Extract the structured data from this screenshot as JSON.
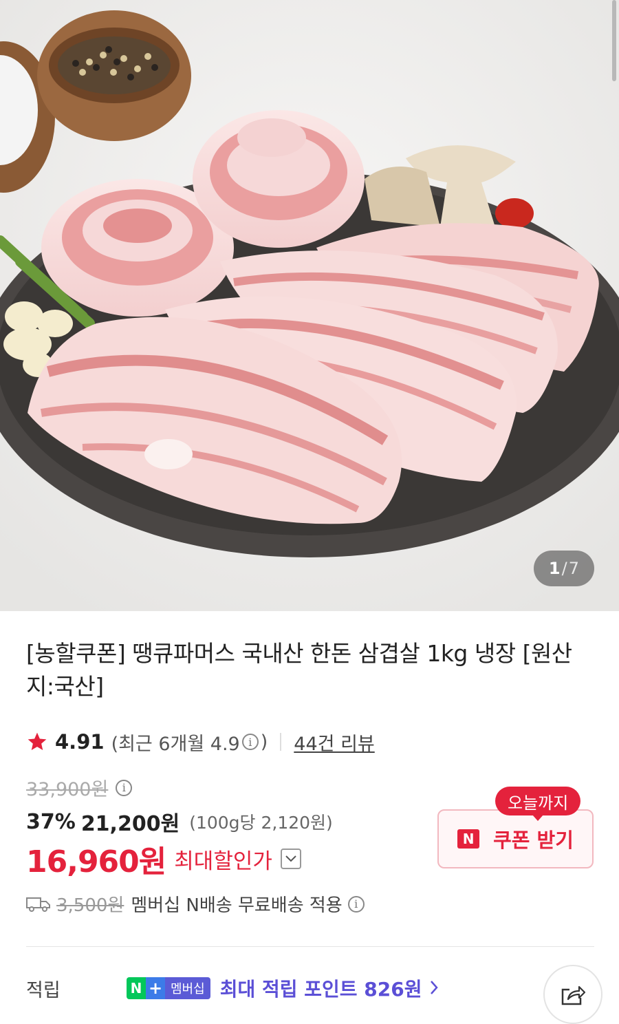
{
  "gallery": {
    "current": "1",
    "separator": "/",
    "total": "7"
  },
  "product": {
    "title": "[농할쿠폰] 땡큐파머스 국내산 한돈 삼겹살 1kg 냉장 [원산지:국산]"
  },
  "rating": {
    "score": "4.91",
    "recent_prefix": "(최근 6개월 4.9",
    "recent_suffix": ")",
    "reviews": "44건 리뷰"
  },
  "price": {
    "original": "33,900원",
    "discount": "37%",
    "sale": "21,200원",
    "unit": "(100g당 2,120원)",
    "max_price": "16,960원",
    "max_label": "최대할인가"
  },
  "coupon": {
    "badge": "오늘까지",
    "icon_letter": "N",
    "label": "쿠폰 받기"
  },
  "shipping": {
    "original_fee": "3,500원",
    "text": "멤버십 N배송 무료배송 적용"
  },
  "points": {
    "label": "적립",
    "badge_n": "N",
    "badge_plus": "+",
    "badge_member": "멤버십",
    "text": "최대 적립 포인트 826원"
  },
  "colors": {
    "accent": "#e4223c",
    "points": "#5b4fd6",
    "naver_green": "#03c75a"
  }
}
